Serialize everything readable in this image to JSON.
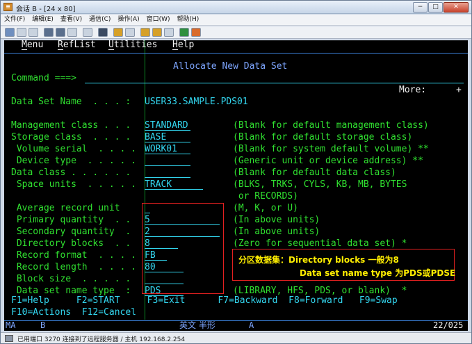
{
  "window": {
    "title": "会话 B - [24 x 80]",
    "minimize": "−",
    "maximize": "□",
    "close": "✕"
  },
  "menubar": [
    "文件(F)",
    "编辑(E)",
    "查看(V)",
    "通信(C)",
    "操作(A)",
    "窗口(W)",
    "帮助(H)"
  ],
  "terminal": {
    "menu": [
      "Menu",
      "RefList",
      "Utilities",
      "Help"
    ],
    "panel_title": "Allocate New Data Set",
    "command_label": "Command ===>",
    "more": "More:",
    "plus": "+",
    "dsname_label": "Data Set Name  . . . :",
    "dsname_value": "USER33.SAMPLE.PDS01",
    "fields": [
      {
        "label": "Management class . . .",
        "value": "STANDARD",
        "hint": "(Blank for default management class)"
      },
      {
        "label": "Storage class  . . . .",
        "value": "BASE",
        "hint": "(Blank for default storage class)"
      },
      {
        "label": " Volume serial  . . . .",
        "value": "WORK01",
        "hint": "(Blank for system default volume) **"
      },
      {
        "label": " Device type  . . . . .",
        "value": "",
        "hint": "(Generic unit or device address) **"
      },
      {
        "label": "Data class . . . . . .",
        "value": "",
        "hint": "(Blank for default data class)"
      },
      {
        "label": " Space units  . . . . .",
        "value": "TRACK",
        "hint": "(BLKS, TRKS, CYLS, KB, MB, BYTES"
      },
      {
        "label": "",
        "value": "",
        "hint": " or RECORDS)"
      },
      {
        "label": " Average record unit",
        "value": "",
        "hint": "(M, K, or U)"
      },
      {
        "label": " Primary quantity  . .",
        "value": "5",
        "hint": "(In above units)"
      },
      {
        "label": " Secondary quantity  .",
        "value": "2",
        "hint": "(In above units)"
      },
      {
        "label": " Directory blocks  . .",
        "value": "8",
        "hint": "(Zero for sequential data set) *"
      },
      {
        "label": " Record format  . . . .",
        "value": "FB",
        "hint": ""
      },
      {
        "label": " Record length  . . . .",
        "value": "80",
        "hint": ""
      },
      {
        "label": " Block size  . . . . .",
        "value": "",
        "hint": ""
      },
      {
        "label": " Data set name type  :",
        "value": "PDS",
        "hint": "(LIBRARY, HFS, PDS, or blank)  *"
      }
    ],
    "pfkeys_1": "F1=Help     F2=START     F3=Exit      F7=Backward  F8=Forward   F9=Swap",
    "pfkeys_2": "F10=Actions  F12=Cancel",
    "annotation_line1": "分区数据集：Directory blocks 一般为8",
    "annotation_line2": "Data set name type 为PDS或PDSE",
    "oia_left": "MA",
    "oia_b": "B",
    "oia_ime": "英文 半形",
    "oia_a": "A",
    "oia_pos": "22/025"
  },
  "statusbar": {
    "text": "已用端口 3270 连接到了远程服务器 / 主机 192.168.2.254"
  }
}
